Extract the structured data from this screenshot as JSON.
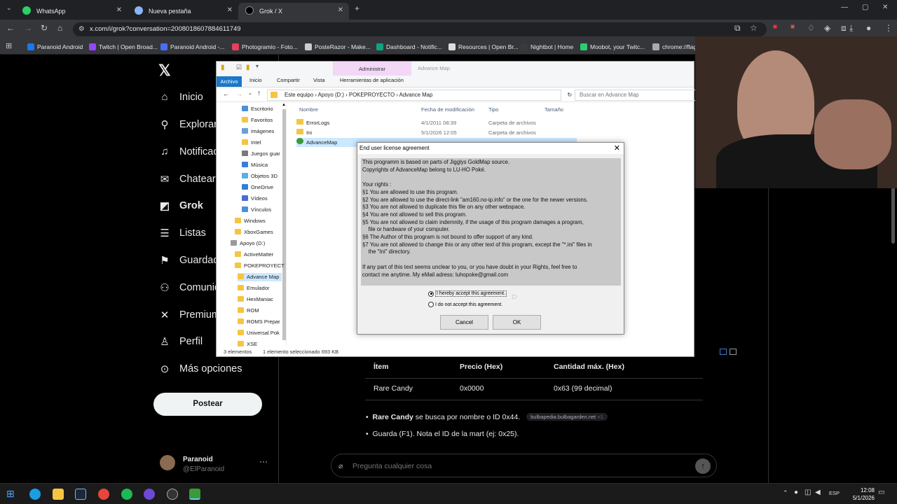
{
  "browser": {
    "tabs": [
      {
        "label": "WhatsApp"
      },
      {
        "label": "Nueva pestaña"
      },
      {
        "label": "Grok / X"
      }
    ],
    "url": "x.com/i/grok?conversation=2008018607884611749",
    "bookmarks": [
      {
        "label": "Paranoid Android",
        "color": "#1877f2"
      },
      {
        "label": "Twitch | Open Broad...",
        "color": "#9146ff"
      },
      {
        "label": "Paranoid Android -...",
        "color": "#4a6cf7"
      },
      {
        "label": "Photogramio - Foto...",
        "color": "#e4405f"
      },
      {
        "label": "PosteRazor - Make...",
        "color": "#cccccc"
      },
      {
        "label": "Dashboard - Notific...",
        "color": "#10a37f"
      },
      {
        "label": "Resources | Open Br...",
        "color": "#dddddd"
      },
      {
        "label": "Nightbot | Home",
        "color": "#3a3a3a"
      },
      {
        "label": "Moobot, your Twitc...",
        "color": "#2ecc71"
      },
      {
        "label": "chrome://flag",
        "color": "#aaaaaa"
      }
    ]
  },
  "x_nav": {
    "items": [
      {
        "label": "Inicio",
        "icon": "home-icon"
      },
      {
        "label": "Explorar",
        "icon": "search-icon"
      },
      {
        "label": "Notificaciones",
        "icon": "bell-icon"
      },
      {
        "label": "Chatear",
        "icon": "mail-icon"
      },
      {
        "label": "Grok",
        "icon": "grok-icon"
      },
      {
        "label": "Listas",
        "icon": "list-icon"
      },
      {
        "label": "Guardados",
        "icon": "bookmark-icon"
      },
      {
        "label": "Comunidades",
        "icon": "people-icon"
      },
      {
        "label": "Premium",
        "icon": "x-icon"
      },
      {
        "label": "Perfil",
        "icon": "user-icon"
      },
      {
        "label": "Más opciones",
        "icon": "more-icon"
      }
    ],
    "post_button": "Postear",
    "profile": {
      "name": "Paranoid",
      "handle": "@ElParanoid"
    }
  },
  "grok": {
    "table": {
      "headers": [
        "Ítem",
        "Precio (Hex)",
        "Cantidad máx. (Hex)"
      ],
      "row": [
        "Rare Candy",
        "0x0000",
        "0x63 (99 decimal)"
      ]
    },
    "bullets": [
      {
        "bold": "Rare Candy",
        "text": " se busca por nombre o ID 0x44.",
        "source": "bulbapedia.bulbagarden.net",
        "extra": "+1"
      },
      {
        "bold": "",
        "text": "Guarda (F1). Nota el ID de la mart (ej: 0x25).",
        "source": "",
        "extra": ""
      }
    ],
    "ask_placeholder": "Pregunta cualquier cosa"
  },
  "explorer": {
    "context_tab": "Administrar",
    "title": "Advance Map",
    "ribbon_tabs": [
      "Archivo",
      "Inicio",
      "Compartir",
      "Vista",
      "Herramientas de aplicación"
    ],
    "breadcrumb": "Este equipo  ›  Apoyo (D:)  ›  POKEPROYECTO  ›  Advance Map",
    "search_placeholder": "Buscar en Advance Map",
    "tree": [
      {
        "label": "Escritorio",
        "color": "#4a90d9"
      },
      {
        "label": "Favoritos",
        "color": "#f5c542"
      },
      {
        "label": "Imágenes",
        "color": "#6aa0d8"
      },
      {
        "label": "Intel",
        "color": "#f5c542"
      },
      {
        "label": "Juegos guar",
        "color": "#7a7a7a"
      },
      {
        "label": "Música",
        "color": "#3b7dd8"
      },
      {
        "label": "Objetos 3D",
        "color": "#5ab0e0"
      },
      {
        "label": "OneDrive",
        "color": "#2f7fd6"
      },
      {
        "label": "Vídeos",
        "color": "#4a6bd6"
      },
      {
        "label": "Vínculos",
        "color": "#4a90d9"
      },
      {
        "label": "Windows",
        "color": "#f5c542"
      },
      {
        "label": "XboxGames",
        "color": "#f5c542"
      },
      {
        "label": "Apoyo (D:)",
        "color": "#9a9a9a"
      },
      {
        "label": "ActiveMatter",
        "color": "#f5c542"
      },
      {
        "label": "POKEPROYECT",
        "color": "#f5c542"
      },
      {
        "label": "Advance Map",
        "color": "#f5c542"
      },
      {
        "label": "Emulador",
        "color": "#f5c542"
      },
      {
        "label": "HexManiac",
        "color": "#f5c542"
      },
      {
        "label": "ROM",
        "color": "#f5c542"
      },
      {
        "label": "ROMS Prepar",
        "color": "#f5c542"
      },
      {
        "label": "Universal Pok",
        "color": "#f5c542"
      },
      {
        "label": "XSE",
        "color": "#f5c542"
      }
    ],
    "columns": [
      "Nombre",
      "Fecha de modificación",
      "Tipo",
      "Tamaño"
    ],
    "files": [
      {
        "name": "ErrorLogs",
        "date": "4/1/2011 08:39",
        "type": "Carpeta de archivos",
        "size": ""
      },
      {
        "name": "Ini",
        "date": "5/1/2026 12:05",
        "type": "Carpeta de archivos",
        "size": ""
      },
      {
        "name": "AdvanceMap",
        "date": "",
        "type": "",
        "size": ""
      }
    ],
    "status_count": "3 elementos",
    "status_selection": "1 elemento seleccionado  693 KB"
  },
  "dialog": {
    "title": "End user license agreement",
    "text": "This programm is based on parts of Jigglys GoldMap source.\nCopyrights of AdvanceMap belong to LU-HO Poké.\n\nYour rights :\n§1 You are allowed to use this program.\n§2 You are allowed to use the direct-link \"am160.no-ip.info\" or the one for the newer versions.\n§3 You are not allowed to duplicate this file on any other webspace.\n§4 You are not allowed to sell this program.\n§5 You are not allowed to claim indemnity, if the usage of this program damages a program,\n    file or hardware of your computer.\n§6 The Author of this program is not bound to offer support of any kind.\n§7 You are not allowed to change this or any other text of this program, except the \"*.ini\" files in\n    the \"Ini\" directory.\n\nIf any part of this text seems unclear to you, or you have doubt in your Rights, feel free to\ncontact me anytime. My eMail adress: luhopoke@gmail.com",
    "accept_label": "I hereby accept this agreement.",
    "decline_label": "I do not accept this agreement.",
    "accept_selected": true,
    "cancel_label": "Cancel",
    "ok_label": "OK"
  },
  "taskbar": {
    "time": "12:08",
    "date": "5/1/2026",
    "lang": "ESP"
  }
}
